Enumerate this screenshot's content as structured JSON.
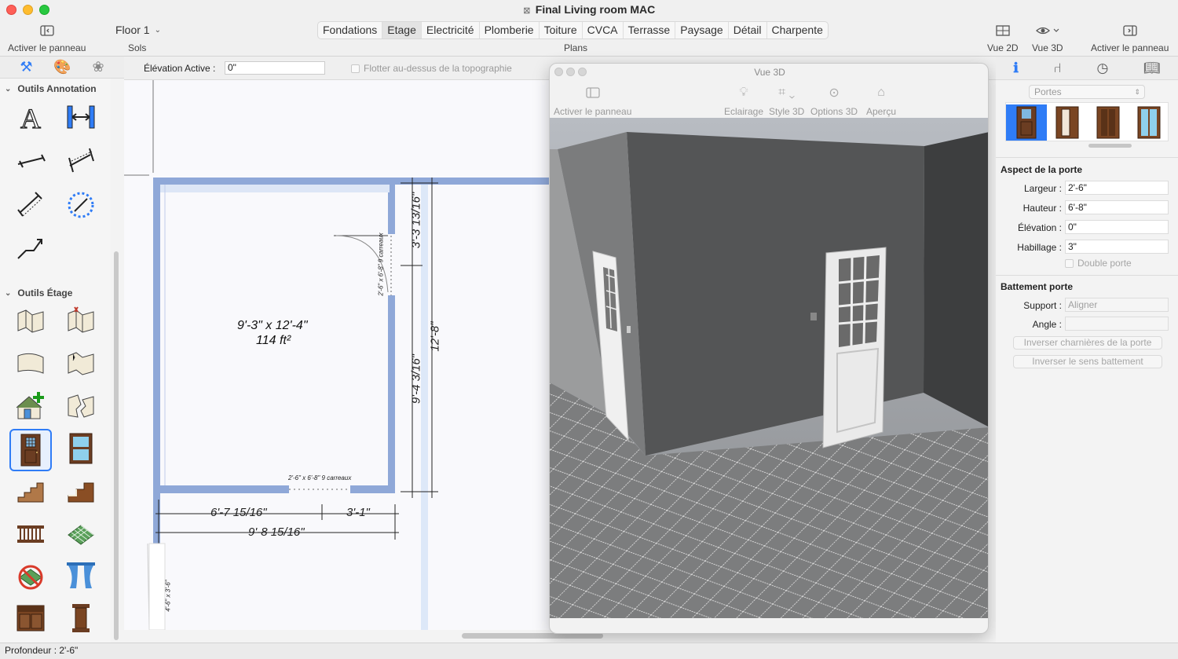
{
  "window": {
    "title": "Final Living room MAC"
  },
  "toolbar": {
    "left_panel_label": "Activer le panneau",
    "floor_select": "Floor 1",
    "floor_caption": "Sols",
    "plan_tabs": [
      "Fondations",
      "Etage",
      "Electricité",
      "Plomberie",
      "Toiture",
      "CVCA",
      "Terrasse",
      "Paysage",
      "Détail",
      "Charpente"
    ],
    "active_plan_tab": "Etage",
    "plans_caption": "Plans",
    "view2d_label": "Vue 2D",
    "view3d_label": "Vue 3D",
    "right_panel_label": "Activer le panneau"
  },
  "left_palette": {
    "section_annotation": "Outils Annotation",
    "section_etage": "Outils Étage",
    "selected_tool": "door-tool"
  },
  "sub_toolbar": {
    "elevation_label": "Élévation Active :",
    "elevation_value": "0\"",
    "float_label": "Flotter au-dessus de la topographie"
  },
  "plan": {
    "room_dims": "9'-3\" x 12'-4\"",
    "room_area": "114 ft²",
    "dim_top_right": "3'-3 13/16\"",
    "dim_mid_right": "9'-4 3/16\"",
    "dim_total_right": "12'-8\"",
    "dim_bottom_left": "6'-7 15/16\"",
    "dim_bottom_right": "3'-1\"",
    "dim_bottom_total": "9'-8 15/16\"",
    "door_label_right": "2'-6\" x 6'-8\" 9 carreaux",
    "door_label_bottom": "2'-6\" x 6'-8\" 9 carreaux",
    "window_label_left": "4'-6\" x 3'-6\""
  },
  "view3d": {
    "title": "Vue 3D",
    "btn_panel": "Activer le panneau",
    "btn_lighting": "Eclairage",
    "btn_style": "Style 3D",
    "btn_options": "Options 3D",
    "btn_preview": "Aperçu"
  },
  "inspector": {
    "category": "Portes",
    "section_aspect": "Aspect de la porte",
    "largeur_label": "Largeur :",
    "largeur_value": "2'-6\"",
    "hauteur_label": "Hauteur :",
    "hauteur_value": "6'-8\"",
    "elevation_label": "Élévation :",
    "elevation_value": "0\"",
    "habillage_label": "Habillage :",
    "habillage_value": "3\"",
    "double_label": "Double porte",
    "section_battement": "Battement porte",
    "support_label": "Support :",
    "support_value": "Aligner",
    "angle_label": "Angle :",
    "angle_value": "",
    "btn_hinges": "Inverser charnières de la porte",
    "btn_swing": "Inverser le sens battement"
  },
  "status": {
    "text": "Profondeur : 2'-6\""
  },
  "colors": {
    "accent": "#2f7cf6",
    "wall": "#8fa8d8",
    "door_wood": "#6b3d22"
  }
}
